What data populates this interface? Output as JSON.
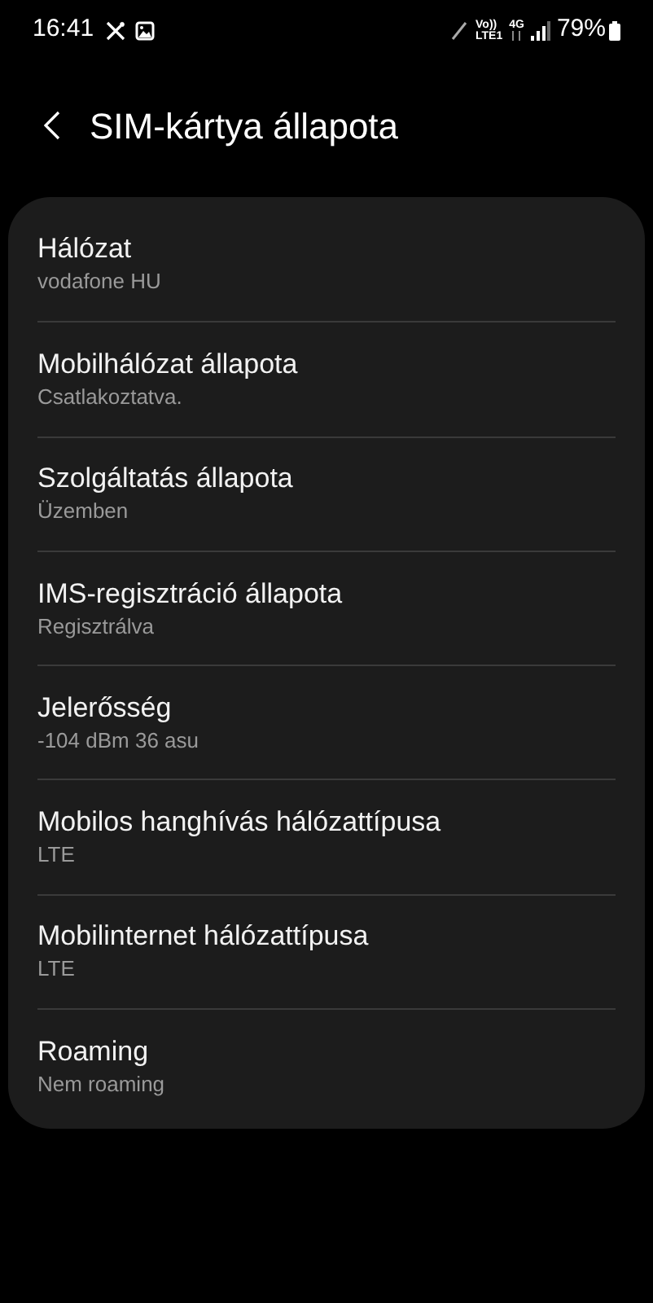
{
  "status_bar": {
    "time": "16:41",
    "volte_top": "Vo))",
    "volte_bottom": "LTE1",
    "network_type": "4G",
    "battery": "79%"
  },
  "header": {
    "title": "SIM-kártya állapota"
  },
  "items": [
    {
      "title": "Hálózat",
      "value": "vodafone HU"
    },
    {
      "title": "Mobilhálózat állapota",
      "value": "Csatlakoztatva."
    },
    {
      "title": "Szolgáltatás állapota",
      "value": "Üzemben"
    },
    {
      "title": "IMS-regisztráció állapota",
      "value": "Regisztrálva"
    },
    {
      "title": "Jelerősség",
      "value": "-104 dBm 36 asu"
    },
    {
      "title": "Mobilos hanghívás hálózattípusa",
      "value": "LTE"
    },
    {
      "title": "Mobilinternet hálózattípusa",
      "value": "LTE"
    },
    {
      "title": "Roaming",
      "value": "Nem roaming"
    }
  ]
}
